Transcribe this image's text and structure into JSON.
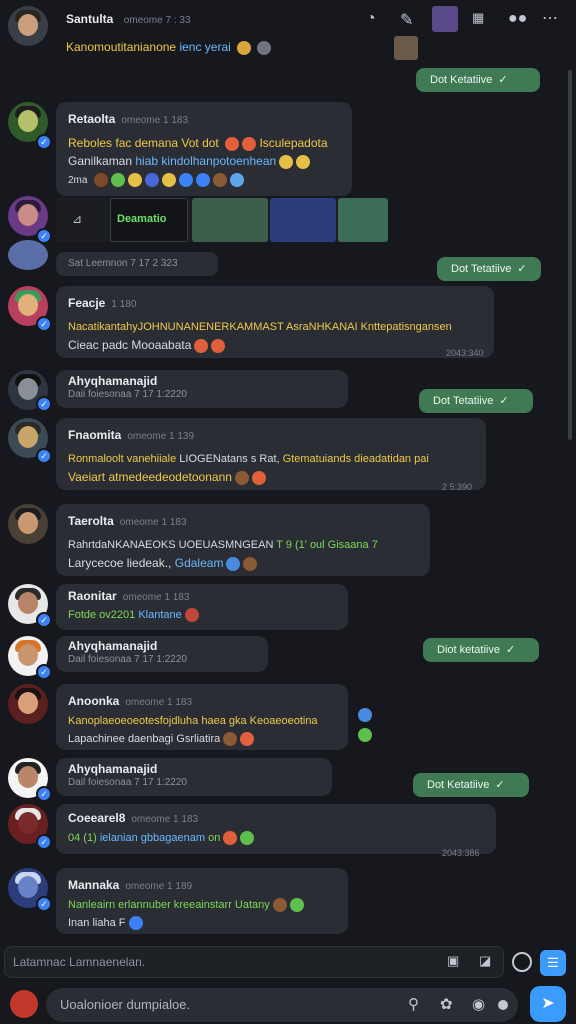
{
  "header": {
    "name": "Santulta",
    "meta": "omeome 7 : 33",
    "line1_yellow": "Kanomoutitanianone",
    "line1_blue": "ienc yerai",
    "icons": [
      "clock-icon",
      "tools-icon",
      "profile-thumbnail",
      "grid-icon",
      "dots-icon",
      "more-icon"
    ]
  },
  "colors": {
    "bg": "#16181d",
    "bubble": "#2a2d33",
    "outgoing": "#3f7a55",
    "yellow": "#f0c94a",
    "green": "#7ed957",
    "blue": "#6bb8ff",
    "send": "#3b9bff"
  },
  "outgoing": [
    {
      "label": "Dot Ketatiive"
    },
    {
      "label": "Dot Tetatiive"
    },
    {
      "label": "Dot Tetatiive"
    },
    {
      "label": "Diot ketatiive"
    },
    {
      "label": "Dot Ketatiive"
    }
  ],
  "messages": [
    {
      "name": "Retaolta",
      "meta": "omeome 1 183",
      "line1_yellow": "Reboles fac demana Vot dot",
      "line1_tail": "Isculepadota",
      "line2": "Ganilkaman",
      "line2_blue": "hiab",
      "line2_rest": "kindolhanpotoenhean",
      "line3_prefix": "2ma"
    },
    {
      "media_label": "Deamatio",
      "sub": "Sat Leemnon 7 17 2 323"
    },
    {
      "name": "Feacje",
      "meta": "1 180",
      "line1_yellow": "NacatikantahyJOHNUNANENERKAMMAST AsraNHKANAI Knttepatisngansen",
      "line2": "Cieac padc Mooaabata",
      "ts": "2043:340"
    },
    {
      "name": "Ahyqhamanajid",
      "sub": "Daii foiesonaa 7 17 1:2220"
    },
    {
      "name": "Fnaomita",
      "meta": "omeome 1 139",
      "line1_yellow": "Ronmaloolt vanehiiale",
      "line1_mid": "LIOGENatans s Rat,",
      "line1_yellow2": "Gtematuiands dieadatidan",
      "line1_tail": "pai",
      "line2_yellow": "Vaeiart atmedeedeodetoonann",
      "ts": "2 5:390"
    },
    {
      "name": "Taerolta",
      "meta": "omeome 1 183",
      "line1": "RahrtdaNKANAEOKS UOEUASMNGEAN",
      "line1_green": "T 9 (1' oul Gisaana 7",
      "line2": "Larycecoe liedeak.,",
      "line2_blue": "Gdaleam"
    },
    {
      "name": "Raonitar",
      "meta": "omeome 1 183",
      "line1_green": "Fotde ov2201",
      "line1_blue": "Klantane"
    },
    {
      "name": "Ahyqhamanajid",
      "sub": "Dail foiesonaa 7 17 1:2220"
    },
    {
      "name": "Anoonka",
      "meta": "omeome 1 183",
      "line1_yellow": "Kanoplaeoeoeotesfojdluha haea gka Keoaeoeotina",
      "line2": "Lapachinee daenbagi",
      "line2_tail": "Gsrliatira"
    },
    {
      "name": "Ahyqhamanajid",
      "sub": "Dail foiesonaa 7 17 1:2220"
    },
    {
      "name": "Coeearel8",
      "meta": "omeome 1 183",
      "line1_green": "04 (1)",
      "line1_blue": "ielanian gbbagaenam",
      "line1_tail": "on",
      "ts": "2043:386"
    },
    {
      "name": "Mannaka",
      "meta": "omeome 1 189",
      "line1_green": "Nanleairn erlannuber kreeainstarr Uatany",
      "line2": "Inan liaha",
      "line2_tail": "F"
    }
  ],
  "composer": {
    "placeholder_top": "Latamnac Lamnaenelan.",
    "placeholder_bottom": "Uoalonioer dumpialoe."
  }
}
